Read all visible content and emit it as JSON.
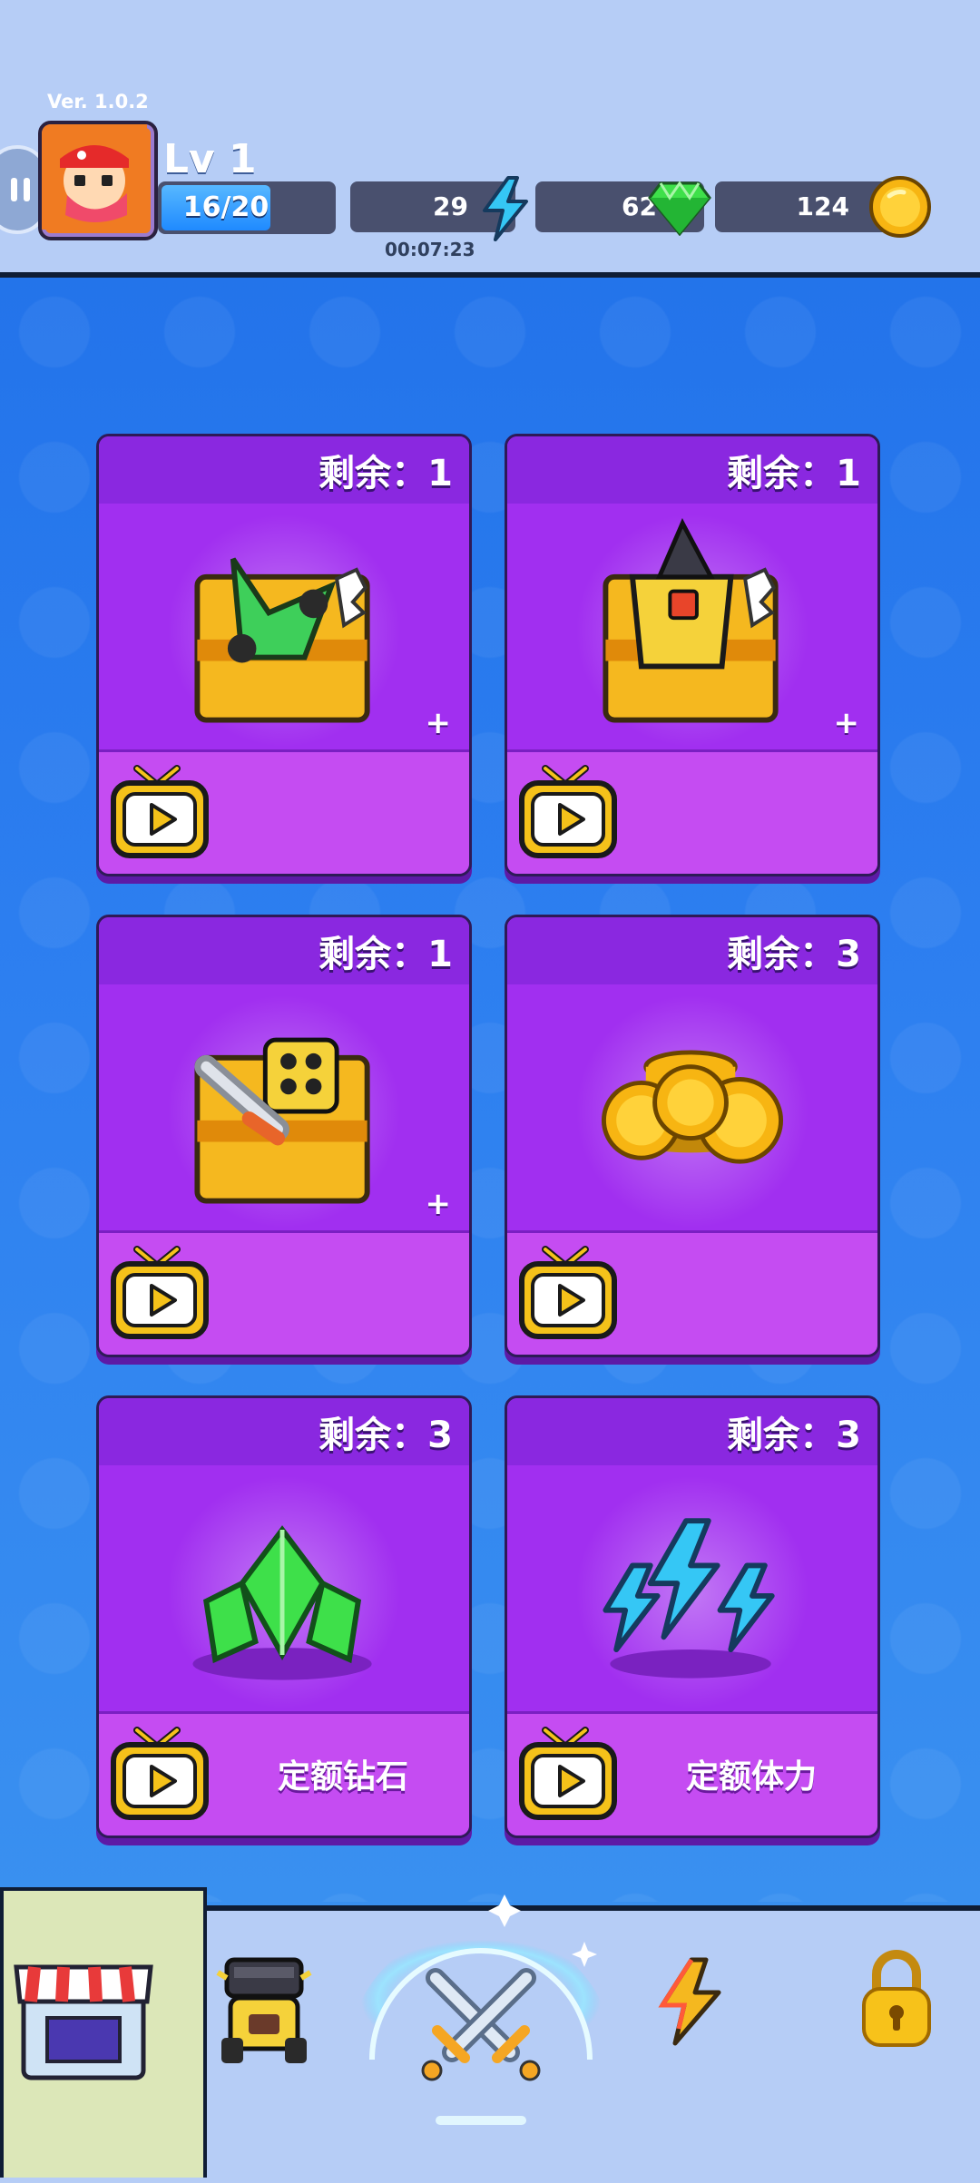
{
  "header": {
    "version": "Ver. 1.0.2",
    "level": "Lv 1",
    "xp": {
      "text": "16/20",
      "fraction": 0.8
    },
    "energy": "29",
    "gems": "62",
    "coins": "124",
    "timer": "00:07:23"
  },
  "icons": {
    "pause": "pause-icon",
    "energy": "lightning-icon",
    "gem": "green-gem-icon",
    "coin": "gold-coin-icon",
    "ad": "tv-play-icon"
  },
  "cards": [
    {
      "remaining": "剩余：1",
      "prize": "chest-with-green-vehicle",
      "amount": "+",
      "label": ""
    },
    {
      "remaining": "剩余：1",
      "prize": "chest-with-yellow-drill-robot",
      "amount": "+",
      "label": ""
    },
    {
      "remaining": "剩余：1",
      "prize": "chest-with-cannon-robot",
      "amount": "+",
      "label": ""
    },
    {
      "remaining": "剩余：3",
      "prize": "gold-coin-pile",
      "amount": "",
      "label": ""
    },
    {
      "remaining": "剩余：3",
      "prize": "green-gem-cluster",
      "amount": "",
      "label": "定额钻石"
    },
    {
      "remaining": "剩余：3",
      "prize": "blue-energy-cluster",
      "amount": "",
      "label": "定额体力"
    }
  ],
  "nav": {
    "items": [
      "shop-icon",
      "vehicle-icon",
      "crossed-swords-icon",
      "lightning-upgrade-icon",
      "padlock-icon"
    ],
    "active": "shop-icon"
  },
  "colors": {
    "background": "#2d7ff0",
    "card": "#a12ff0",
    "card_bottom": "#c54cf2",
    "header": "#b6cdf6",
    "resource_bar": "#49506e"
  }
}
